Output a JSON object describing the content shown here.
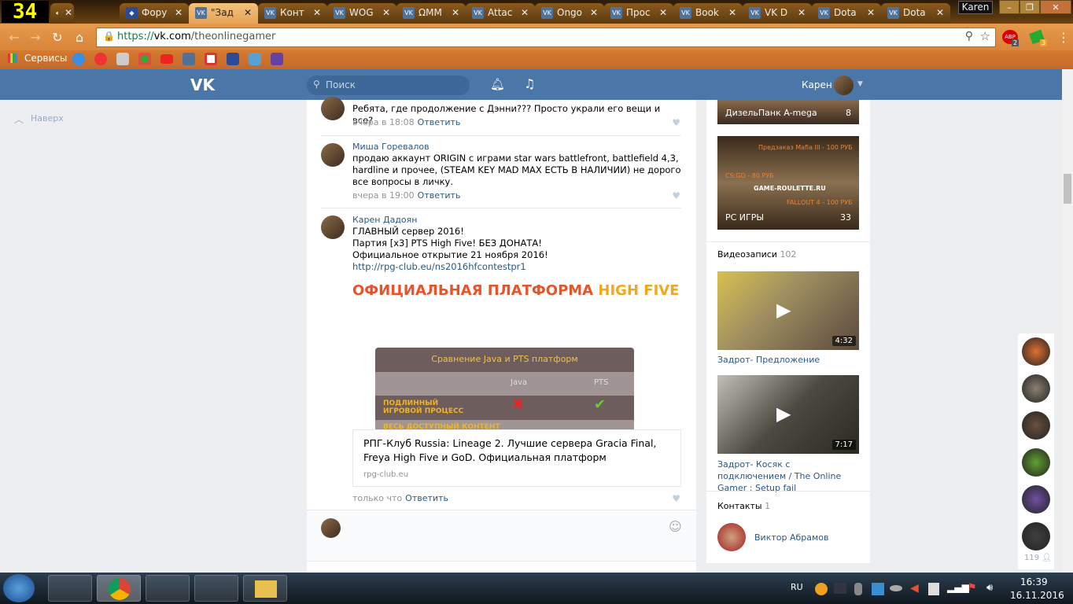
{
  "browser": {
    "counter": "34",
    "tabs": [
      {
        "label": "",
        "icon": "speaker-icon"
      },
      {
        "label": "Фору",
        "icon": "emblem"
      },
      {
        "label": "\"Зад",
        "icon": "vk",
        "active": true
      },
      {
        "label": "Конт",
        "icon": "vk"
      },
      {
        "label": "WOG",
        "icon": "vk"
      },
      {
        "label": "ΩMM",
        "icon": "vk"
      },
      {
        "label": "Attac",
        "icon": "vk"
      },
      {
        "label": "Ongo",
        "icon": "vk"
      },
      {
        "label": "Прос",
        "icon": "vk"
      },
      {
        "label": "Book",
        "icon": "vk"
      },
      {
        "label": "VK D",
        "icon": "vk"
      },
      {
        "label": "Dota",
        "icon": "vk"
      },
      {
        "label": "Dota",
        "icon": "vk"
      }
    ],
    "profile": "Karen",
    "url_scheme": "https://",
    "url_host": "vk.com",
    "url_path": "/theonlinegamer",
    "abp_badge": "2",
    "ext_badge": "3",
    "bookmarks_label": "Сервисы"
  },
  "vk": {
    "search_placeholder": "Поиск",
    "user": "Карен",
    "back_to_top": "Наверх",
    "comments": [
      {
        "author": "",
        "text": "Ребята, где продолжение с Дэнни??? Просто украли его вещи и все?",
        "time": "вчера в 18:08",
        "reply": "Ответить"
      },
      {
        "author": "Миша Горевалов",
        "text": "продаю аккаунт ORIGIN с играми star wars battlefront, battlefield 4,3, hardline и прочее, (STEAM KEY MAD MAX ЕСТЬ В НАЛИЧИИ) не дорого все вопросы в личку.",
        "time": "вчера в 19:00",
        "reply": "Ответить"
      },
      {
        "author": "Карен Дадоян",
        "lines": [
          "ГЛАВНЫЙ сервер 2016!",
          "Партия [x3] PTS High Five! БЕЗ ДОНАТА!",
          "Официальное открытие 21 ноября 2016!"
        ],
        "link": "http://rpg-club.eu/ns2016hfcontestpr1",
        "time": "только что",
        "reply": "Ответить"
      }
    ],
    "banner": {
      "part1": "ОФИЦИАЛЬНАЯ ПЛАТФОРМА",
      "part2": "HIGH FIVE",
      "table_title": "Сравнение Java и PTS платформ",
      "col1": "Java",
      "col2": "PTS",
      "row1a": "ПОДЛИННЫЙ",
      "row1b": "ИГРОВОЙ ПРОЦЕСС",
      "row2": "ВЕСЬ ДОСТУПНЫЙ КОНТЕНТ"
    },
    "link_card": {
      "title": "РПГ-Клуб Russia: Lineage 2. Лучшие сервера Gracia Final, Freya High Five и GoD. Официальная платформ",
      "domain": "rpg-club.eu"
    },
    "albums": [
      {
        "name": "ДизельПанк A-mega",
        "count": "8"
      },
      {
        "name": "PC ИГРЫ",
        "count": "33",
        "overlay": [
          "Предзаказ Mafia III - 100 РУБ",
          "CS:GO - 80 РУБ",
          "GAME-ROULETTE.RU",
          "FALLOUT 4 - 100 РУБ"
        ]
      }
    ],
    "videos_title": "Видеозаписи",
    "videos_count": "102",
    "videos": [
      {
        "title": "Задрот- Предложение",
        "duration": "4:32"
      },
      {
        "title": "Задрот- Косяк с подключением / The Online Gamer : Setup fail",
        "duration": "7:17"
      }
    ],
    "contacts_title": "Контакты",
    "contacts_count": "1",
    "contact": "Виктор Абрамов",
    "friends_online": "119"
  },
  "taskbar": {
    "lang": "RU",
    "time": "16:39",
    "date": "16.11.2016"
  }
}
